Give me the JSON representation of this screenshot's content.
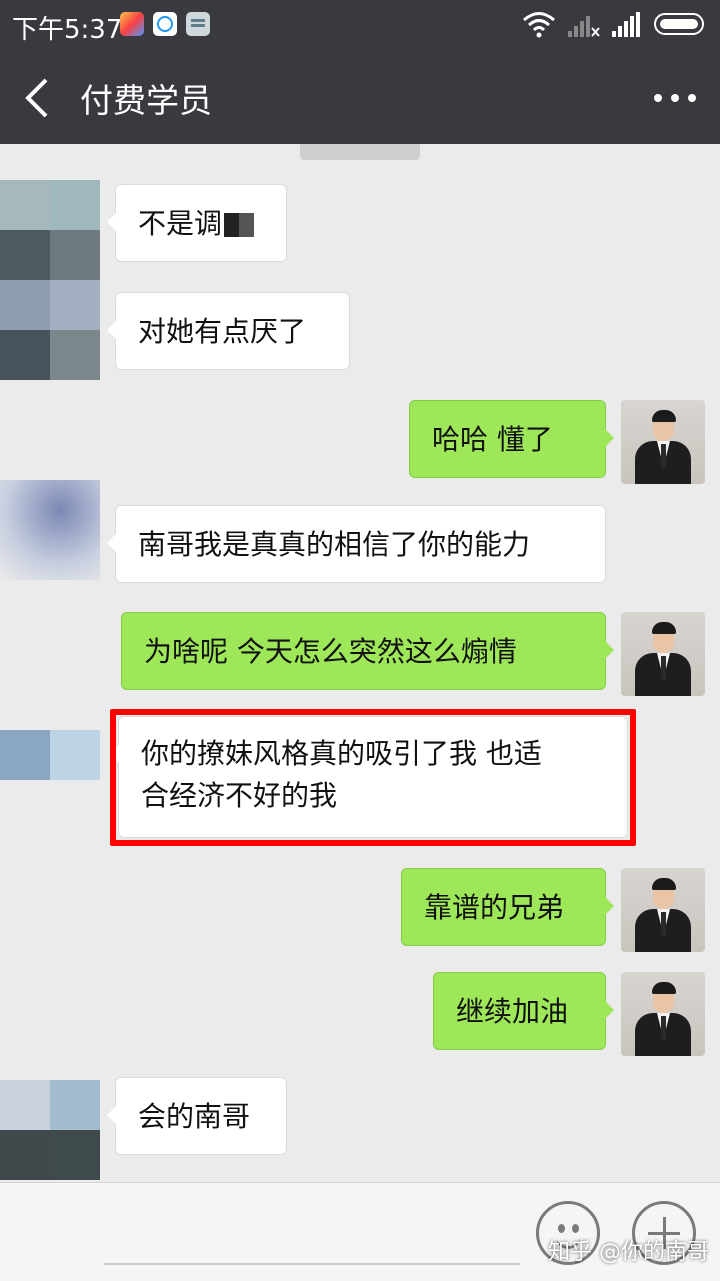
{
  "status_bar": {
    "time": "下午5:37",
    "icons": [
      "photo-app-icon",
      "ifly-app-icon",
      "notes-app-icon",
      "wifi-icon",
      "signal-no-service-icon",
      "signal-icon",
      "battery-icon"
    ]
  },
  "header": {
    "title": "付费学员",
    "back_icon": "chevron-left-icon",
    "more_icon": "more-dots-icon"
  },
  "messages": [
    {
      "side": "left",
      "text": "不是调",
      "redacted_suffix": true
    },
    {
      "side": "left",
      "text": "对她有点厌了"
    },
    {
      "side": "right",
      "text": "哈哈   懂了"
    },
    {
      "side": "left",
      "text": "南哥我是真真的相信了你的能力"
    },
    {
      "side": "right",
      "text": "为啥呢   今天怎么突然这么煽情"
    },
    {
      "side": "left",
      "line1": "你的撩妹风格真的吸引了我   也适",
      "line2": "合经济不好的我",
      "highlighted": true
    },
    {
      "side": "right",
      "text": "靠谱的兄弟"
    },
    {
      "side": "right",
      "text": "继续加油"
    },
    {
      "side": "left",
      "text": "会的南哥"
    }
  ],
  "colors": {
    "header_bg": "#393a3f",
    "chat_bg": "#ebebeb",
    "sent_bubble": "#9ee759",
    "received_bubble": "#ffffff",
    "highlight": "#ff0000"
  },
  "input_bar": {
    "emoji_icon": "emoji-icon",
    "plus_icon": "plus-icon"
  },
  "watermark": "知乎 @你的南哥"
}
